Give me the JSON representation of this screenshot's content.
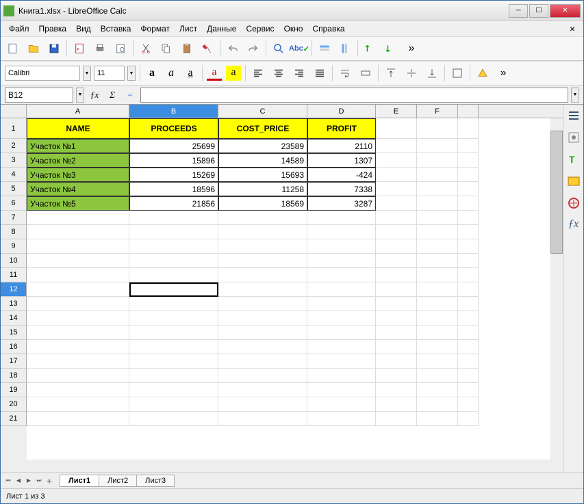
{
  "window": {
    "title": "Книга1.xlsx - LibreOffice Calc"
  },
  "menu": {
    "items": [
      "Файл",
      "Правка",
      "Вид",
      "Вставка",
      "Формат",
      "Лист",
      "Данные",
      "Сервис",
      "Окно",
      "Справка"
    ]
  },
  "font": {
    "name": "Calibri",
    "size": "11"
  },
  "cellref": "B12",
  "columns": [
    "A",
    "B",
    "C",
    "D",
    "E",
    "F",
    ""
  ],
  "selected_col_idx": 1,
  "selected_row": 12,
  "headers": [
    "NAME",
    "PROCEEDS",
    "COST_PRICE",
    "PROFIT"
  ],
  "data_rows": [
    {
      "name": "Участок №1",
      "proceeds": "25699",
      "cost": "23589",
      "profit": "2110"
    },
    {
      "name": "Участок №2",
      "proceeds": "15896",
      "cost": "14589",
      "profit": "1307"
    },
    {
      "name": "Участок №3",
      "proceeds": "15269",
      "cost": "15693",
      "profit": "-424"
    },
    {
      "name": "Участок №4",
      "proceeds": "18596",
      "cost": "11258",
      "profit": "7338"
    },
    {
      "name": "Участок №5",
      "proceeds": "21856",
      "cost": "18569",
      "profit": "3287"
    }
  ],
  "empty_rows": 15,
  "sheets": {
    "active": "Лист1",
    "others": [
      "Лист2",
      "Лист3"
    ]
  },
  "status": "Лист 1 из 3",
  "chart_data": {
    "type": "table",
    "columns": [
      "NAME",
      "PROCEEDS",
      "COST_PRICE",
      "PROFIT"
    ],
    "rows": [
      [
        "Участок №1",
        25699,
        23589,
        2110
      ],
      [
        "Участок №2",
        15896,
        14589,
        1307
      ],
      [
        "Участок №3",
        15269,
        15693,
        -424
      ],
      [
        "Участок №4",
        18596,
        11258,
        7338
      ],
      [
        "Участок №5",
        21856,
        18569,
        3287
      ]
    ]
  }
}
